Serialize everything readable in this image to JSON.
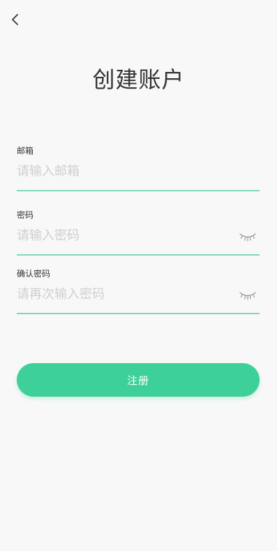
{
  "header": {
    "back_icon": "chevron-left-icon",
    "title": "创建账户"
  },
  "form": {
    "email": {
      "label": "邮箱",
      "placeholder": "请输入邮箱",
      "value": ""
    },
    "password": {
      "label": "密码",
      "placeholder": "请输入密码",
      "value": "",
      "toggle_icon": "eye-closed-icon"
    },
    "confirm_password": {
      "label": "确认密码",
      "placeholder": "请再次输入密码",
      "value": "",
      "toggle_icon": "eye-closed-icon"
    }
  },
  "actions": {
    "register_label": "注册"
  },
  "colors": {
    "accent": "#3dd199",
    "underline": "#7ed9b3",
    "background": "#f8f8f8",
    "text": "#333333",
    "placeholder": "#cfcfcf"
  }
}
